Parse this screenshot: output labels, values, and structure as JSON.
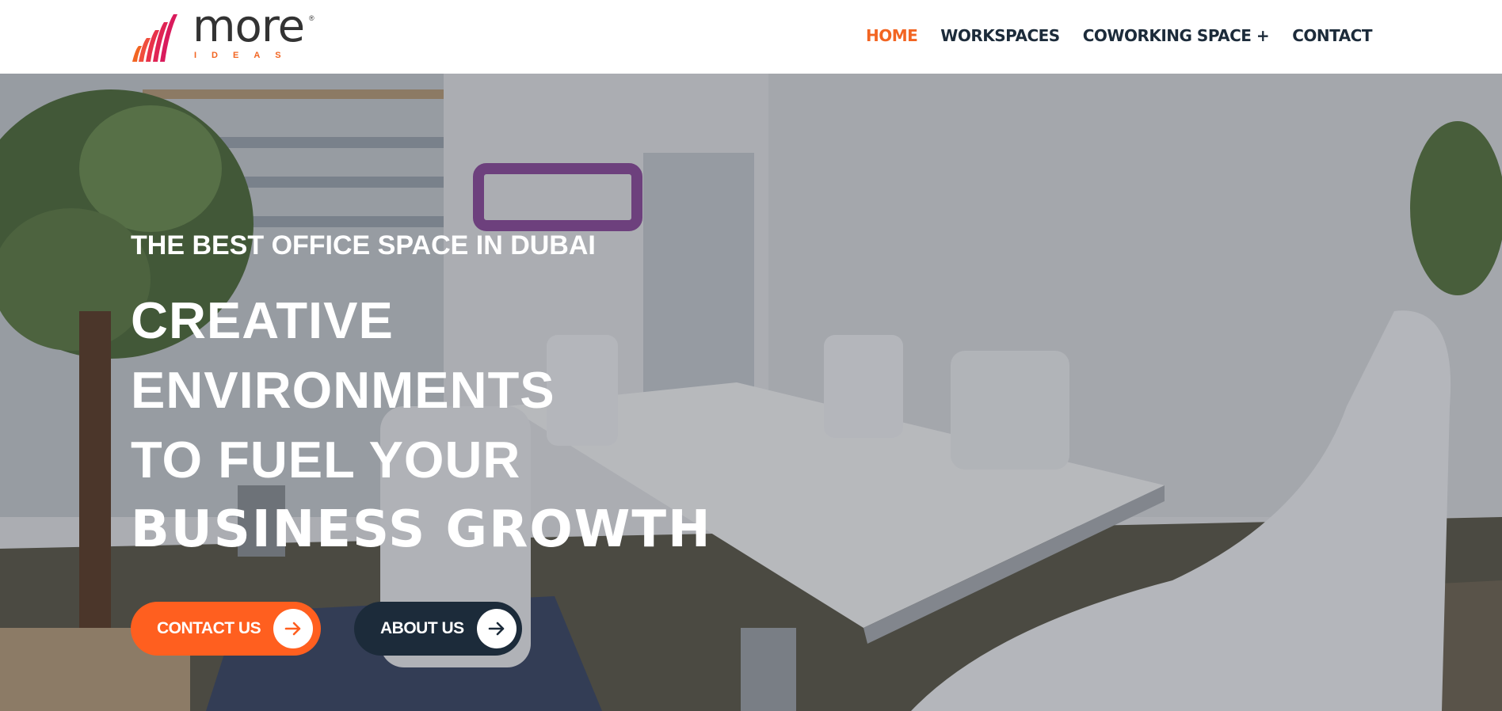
{
  "brand": {
    "logo_word": "more",
    "logo_sub": "IDEAS",
    "registered_mark": "®",
    "accent_color": "#f26522",
    "dark_color": "#1c2b3a"
  },
  "nav": {
    "items": [
      {
        "label": "HOME",
        "active": true
      },
      {
        "label": "WORKSPACES",
        "active": false
      },
      {
        "label": "COWORKING SPACE +",
        "active": false
      },
      {
        "label": "CONTACT",
        "active": false
      }
    ]
  },
  "hero": {
    "eyebrow": "THE BEST OFFICE SPACE IN DUBAI",
    "headline_lines": [
      "CREATIVE",
      "ENVIRONMENTS",
      "TO FUEL YOUR",
      "BUSINESS GROWTH"
    ],
    "background_image": "meeting-room-photo",
    "buttons": {
      "contact": {
        "label": "CONTACT US",
        "icon": "arrow-right-icon",
        "color": "#ff5f1f"
      },
      "about": {
        "label": "ABOUT US",
        "icon": "arrow-right-icon",
        "color": "#1c2b3a"
      }
    }
  }
}
